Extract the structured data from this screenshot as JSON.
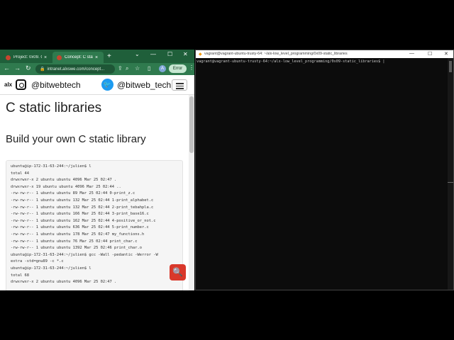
{
  "browser": {
    "tabs": [
      {
        "label": "Project: 0x09. C",
        "close": "×"
      },
      {
        "label": "Concept: C stat",
        "close": "×"
      }
    ],
    "new_tab": "+",
    "window_controls": {
      "chevron": "⌄",
      "minimize": "—",
      "maximize": "☐",
      "close": "✕"
    },
    "nav": {
      "back": "←",
      "forward": "→",
      "reload": "↻"
    },
    "url": "intranet.alxswe.com/concept...",
    "lock": "🔒",
    "tools": {
      "share": "⇪",
      "zoom": "⌕",
      "star": "☆",
      "sidebar": "▯"
    },
    "avatar": "A",
    "error_button": "Error",
    "menu": "⋮"
  },
  "site": {
    "logo_text": "alx",
    "instagram_handle": "@bitwebtech",
    "twitter_glyph": "🐦",
    "twitter_handle": "@bitweb_tech"
  },
  "page": {
    "title": "C static libraries",
    "section": "Build your own C static library",
    "code_lines": [
      "ubuntu@ip-172-31-63-244:~/julien$ l",
      "total 44",
      "drwxrwxr-x 2 ubuntu ubuntu 4096 Mar 25 02:47 .",
      "drwxrwxr-x 19 ubuntu ubuntu 4096 Mar 25 02:44 ..",
      "-rw-rw-r-- 1 ubuntu ubuntu 89 Mar 25 02:44 0-print_z.c",
      "-rw-rw-r-- 1 ubuntu ubuntu 132 Mar 25 02:44 1-print_alphabet.c",
      "-rw-rw-r-- 1 ubuntu ubuntu 132 Mar 25 02:44 2-print_tebahpla.c",
      "-rw-rw-r-- 1 ubuntu ubuntu 166 Mar 25 02:44 3-print_base16.c",
      "-rw-rw-r-- 1 ubuntu ubuntu 162 Mar 25 02:44 4-positive_or_not.c",
      "-rw-rw-r-- 1 ubuntu ubuntu 636 Mar 25 02:44 5-print_number.c",
      "-rw-rw-r-- 1 ubuntu ubuntu 178 Mar 25 02:47 my_functions.h",
      "-rw-rw-r-- 1 ubuntu ubuntu 76 Mar 25 02:44 print_char.c",
      "-rw-rw-r-- 1 ubuntu ubuntu 1392 Mar 25 02:46 print_char.o",
      "ubuntu@ip-172-31-63-244:~/julien$ gcc -Wall -pedantic -Werror -W",
      "extra -std=gnu89 -c *.c",
      "ubuntu@ip-172-31-63-244:~/julien$ l",
      "total 68",
      "drwxrwxr-x 2 ubuntu ubuntu 4096 Mar 25 02:47 ."
    ],
    "search_glyph": "🔍"
  },
  "terminal": {
    "title": "vagrant@vagrant-ubuntu-trusty-64: ~/alx-low_level_programming/0x09-static_libraries",
    "icon": "◆",
    "prompt": "vagrant@vagrant-ubuntu-trusty-64:~/alx-low_level_programming/0x09-static_libraries$ |",
    "controls": {
      "minimize": "—",
      "maximize": "☐",
      "close": "✕"
    }
  }
}
